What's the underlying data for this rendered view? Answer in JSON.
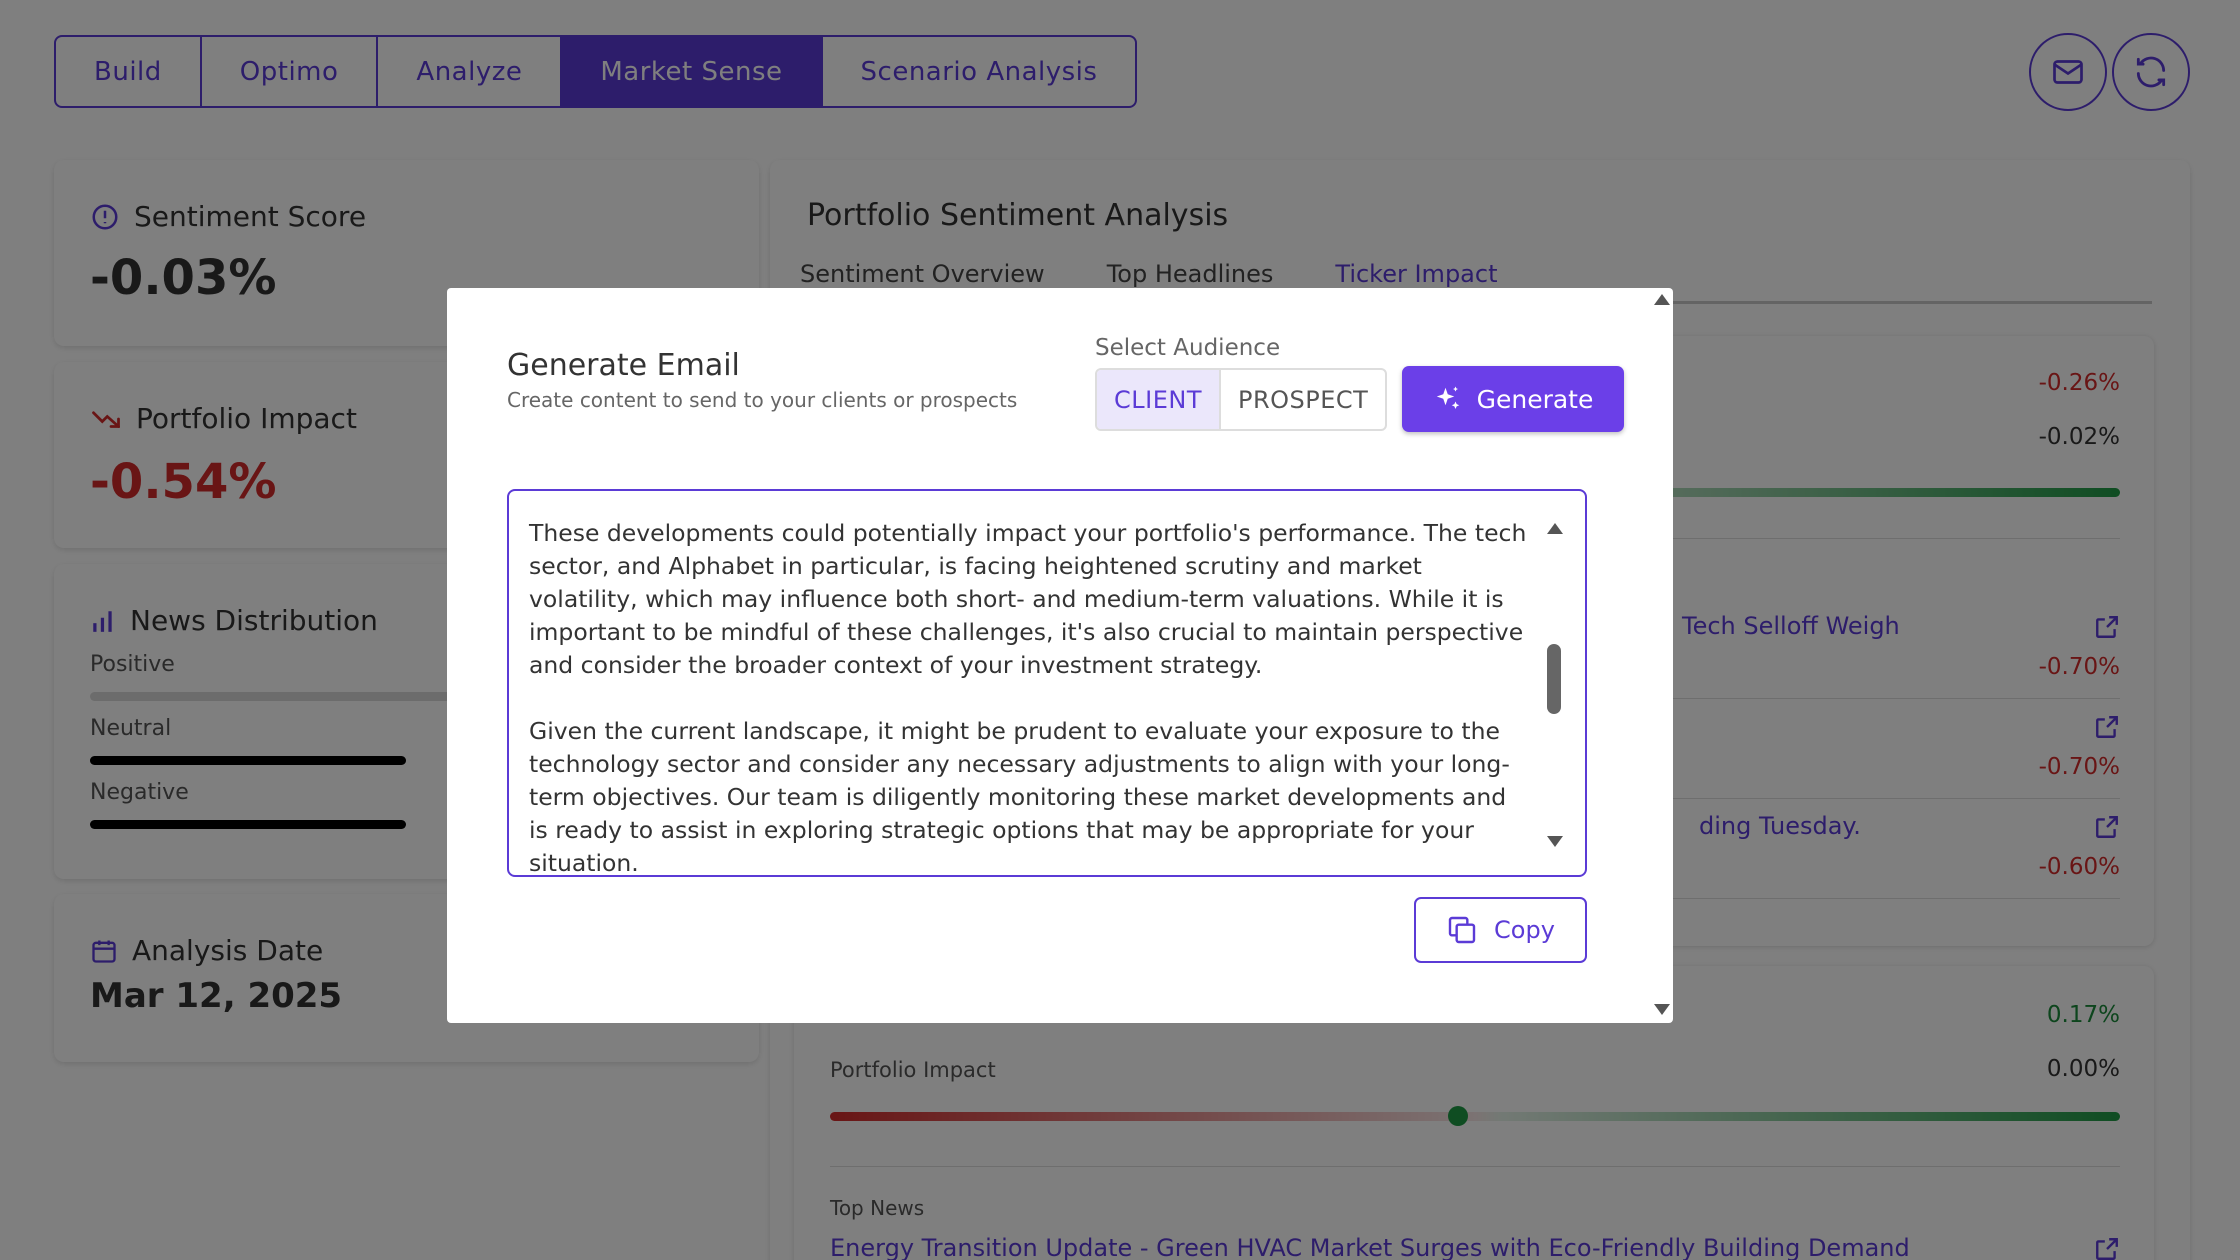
{
  "nav": {
    "tabs": [
      "Build",
      "Optimo",
      "Analyze",
      "Market Sense",
      "Scenario Analysis"
    ],
    "active_tab": "Market Sense"
  },
  "header_icons": [
    "mail-icon",
    "refresh-icon"
  ],
  "left": {
    "sentiment_score": {
      "title": "Sentiment Score",
      "value": "-0.03%"
    },
    "portfolio_impact": {
      "title": "Portfolio Impact",
      "value": "-0.54%"
    },
    "news_distribution": {
      "title": "News Distribution",
      "labels": [
        "Positive",
        "Neutral",
        "Negative"
      ]
    },
    "analysis_date": {
      "title": "Analysis Date",
      "value": "Mar 12, 2025"
    }
  },
  "right": {
    "title": "Portfolio Sentiment Analysis",
    "tabs": [
      "Sentiment Overview",
      "Top Headlines",
      "Ticker Impact"
    ],
    "active_tab": "Ticker Impact",
    "card1": {
      "value1": "-0.26%",
      "value2": "-0.02%",
      "headlines": [
        {
          "text": "Tech Selloff Weigh",
          "value": "-0.70%"
        },
        {
          "text": "",
          "value": "-0.70%"
        },
        {
          "text": "ding Tuesday.",
          "value": "-0.60%"
        }
      ]
    },
    "card2": {
      "value1": "0.17%",
      "impact_label": "Portfolio Impact",
      "impact_value": "0.00%",
      "top_news_label": "Top News",
      "top_news_link": "Energy Transition Update - Green HVAC Market Surges with Eco-Friendly Building Demand"
    }
  },
  "modal": {
    "title": "Generate Email",
    "subtitle": "Create content to send to your clients or prospects",
    "audience_label": "Select Audience",
    "audience_options": [
      "CLIENT",
      "PROSPECT"
    ],
    "selected_audience": "CLIENT",
    "generate_label": "Generate",
    "paragraphs": [
      "These developments could potentially impact your portfolio's performance. The tech sector, and Alphabet in particular, is facing heightened scrutiny and market volatility, which may influence both short- and medium-term valuations. While it is important to be mindful of these challenges, it's also crucial to maintain perspective and consider the broader context of your investment strategy.",
      "Given the current landscape, it might be prudent to evaluate your exposure to the technology sector and consider any necessary adjustments to align with your long-term objectives. Our team is diligently monitoring these market developments and is ready to assist in exploring strategic options that may be appropriate for your situation."
    ],
    "copy_label": "Copy"
  },
  "colors": {
    "accent": "#5b3bd6",
    "generate": "#6b3fe8",
    "negative": "#d22b2b",
    "positive": "#1a8a3a"
  }
}
